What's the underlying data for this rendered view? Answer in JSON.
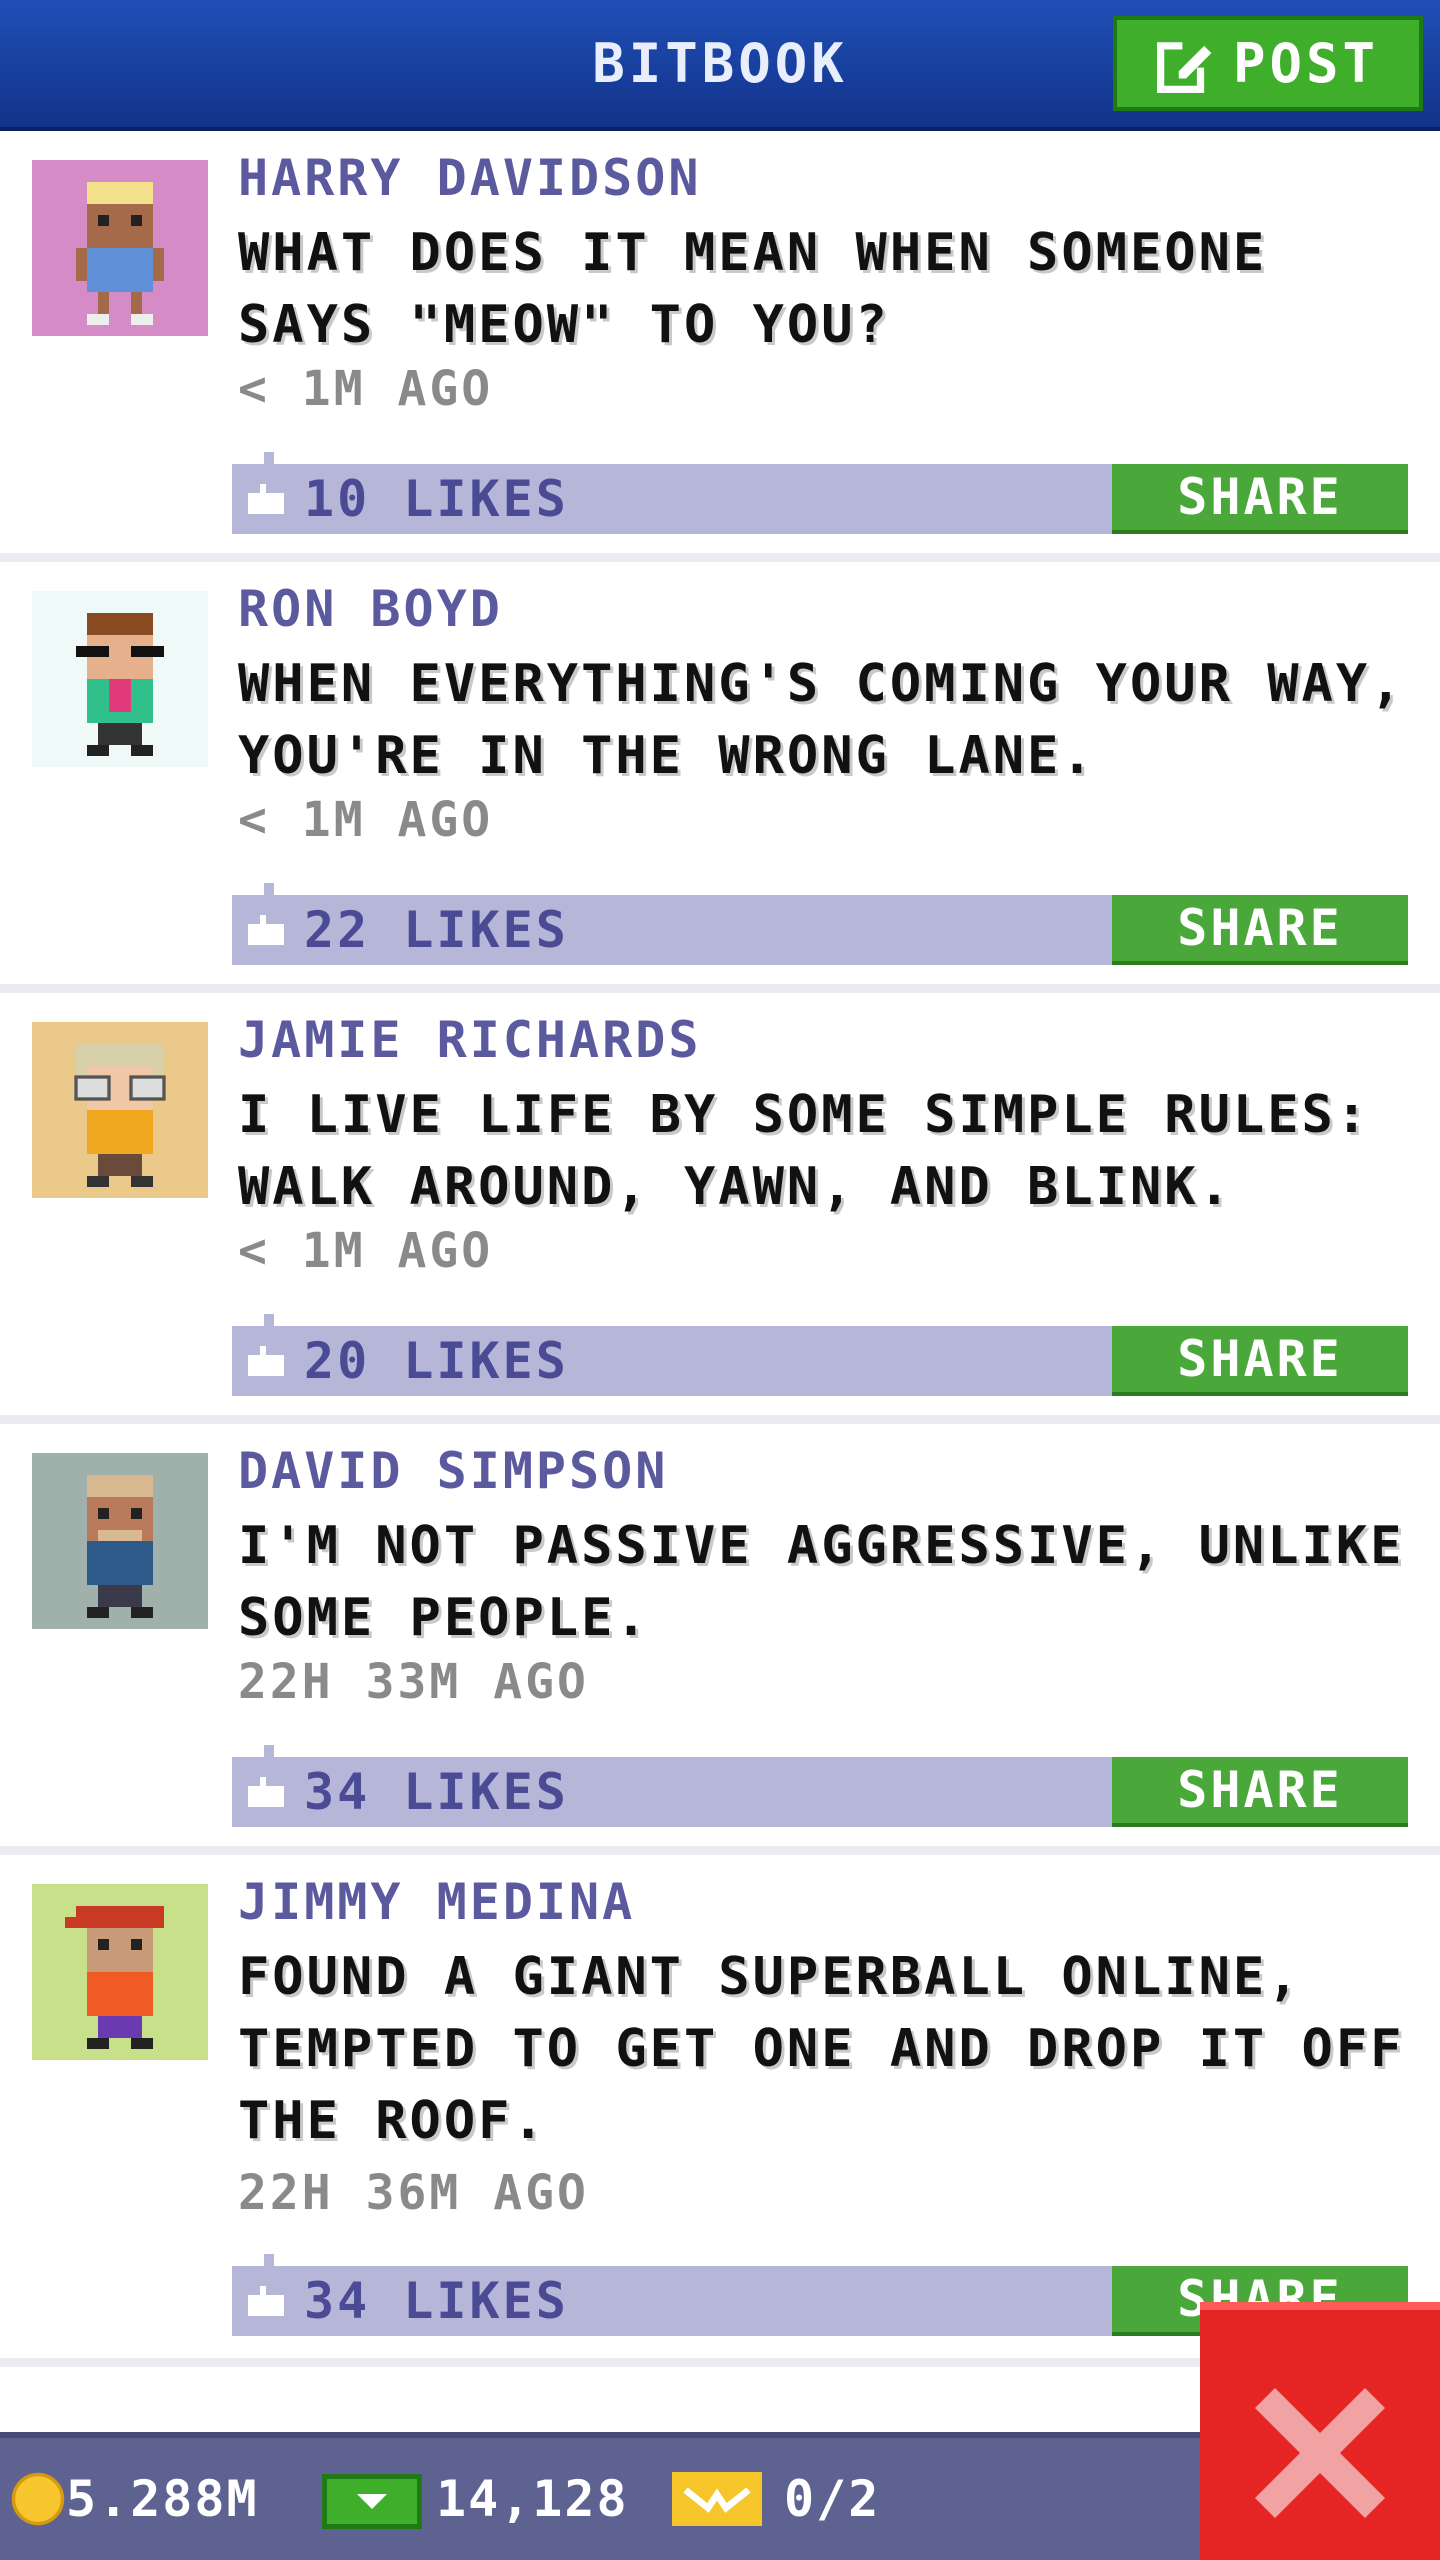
{
  "header": {
    "title": "BITBOOK",
    "post_label": "POST"
  },
  "posts": [
    {
      "name": "HARRY DAVIDSON",
      "text": "WHAT DOES IT MEAN WHEN SOMEONE SAYS \"MEOW\" TO YOU?",
      "time": "< 1M AGO",
      "likes": "10 LIKES",
      "share": "SHARE",
      "avatar_bg": "#d58bc6"
    },
    {
      "name": "RON BOYD",
      "text": "WHEN EVERYTHING'S COMING YOUR WAY, YOU'RE IN THE WRONG LANE.",
      "time": "< 1M AGO",
      "likes": "22 LIKES",
      "share": "SHARE",
      "avatar_bg": "#effaf8"
    },
    {
      "name": "JAMIE RICHARDS",
      "text": "I LIVE LIFE BY SOME SIMPLE RULES: WALK AROUND, YAWN, AND BLINK.",
      "time": "< 1M AGO",
      "likes": "20 LIKES",
      "share": "SHARE",
      "avatar_bg": "#ebc98b"
    },
    {
      "name": "DAVID SIMPSON",
      "text": "I'M NOT PASSIVE AGGRESSIVE, UNLIKE SOME PEOPLE.",
      "time": "22H 33M AGO",
      "likes": "34 LIKES",
      "share": "SHARE",
      "avatar_bg": "#9fb1aa"
    },
    {
      "name": "JIMMY MEDINA",
      "text": "FOUND A GIANT SUPERBALL ONLINE, TEMPTED TO GET ONE AND DROP IT OFF THE ROOF.",
      "time": "22H 36M AGO",
      "likes": "34 LIKES",
      "share": "SHARE",
      "avatar_bg": "#c9e08a"
    }
  ],
  "footer": {
    "coins": "5.288M",
    "bux": "14,128",
    "tickets": "0/2"
  },
  "colors": {
    "header": "#1f4fb6",
    "share": "#4aa83a",
    "like_bar": "#b6b7d8",
    "close": "#e52523",
    "footer": "#5d6290"
  },
  "icons": [
    "post-edit-icon",
    "thumbs-up-icon",
    "coin-icon",
    "bux-icon",
    "ticket-icon",
    "close-x-icon"
  ]
}
